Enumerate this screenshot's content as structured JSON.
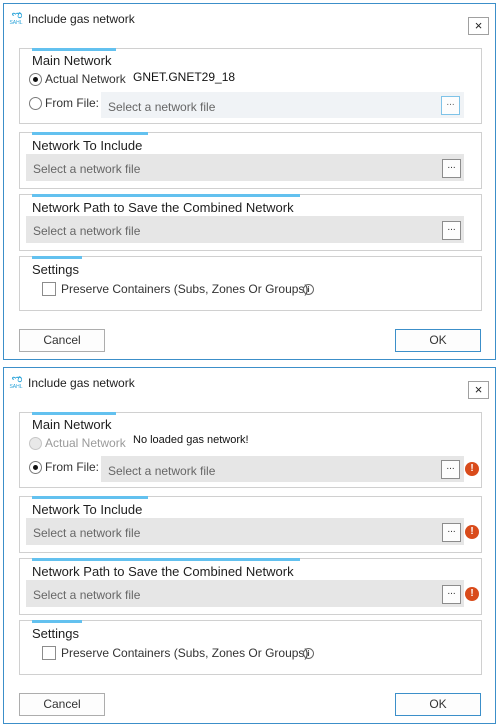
{
  "dialogs": [
    {
      "title": "Include gas network",
      "app_icon_text": "SAHL",
      "close_glyph": "×",
      "main_network": {
        "heading": "Main Network",
        "actual_label": "Actual Network",
        "actual_value": "GNET.GNET29_18",
        "from_file_label": "From File:",
        "file_placeholder": "Select a network file",
        "browse_label": "..."
      },
      "include": {
        "heading": "Network To Include",
        "placeholder": "Select a network file",
        "browse_label": "..."
      },
      "save_path": {
        "heading": "Network Path to Save the Combined Network",
        "placeholder": "Select a network file",
        "browse_label": "..."
      },
      "settings": {
        "heading": "Settings",
        "preserve_label": "Preserve Containers (Subs, Zones Or Groups)",
        "info_glyph": "i"
      },
      "cancel_label": "Cancel",
      "ok_label": "OK"
    },
    {
      "title": "Include gas network",
      "app_icon_text": "SAHL",
      "close_glyph": "×",
      "main_network": {
        "heading": "Main Network",
        "actual_label": "Actual Network",
        "actual_value": "No loaded gas network!",
        "from_file_label": "From File:",
        "file_placeholder": "Select a network file",
        "browse_label": "..."
      },
      "include": {
        "heading": "Network To Include",
        "placeholder": "Select a network file",
        "browse_label": "..."
      },
      "save_path": {
        "heading": "Network Path to Save the Combined Network",
        "placeholder": "Select a network file",
        "browse_label": "..."
      },
      "settings": {
        "heading": "Settings",
        "preserve_label": "Preserve Containers (Subs, Zones Or Groups)",
        "info_glyph": "i"
      },
      "cancel_label": "Cancel",
      "ok_label": "OK"
    }
  ],
  "icons": {
    "error_glyph": "!",
    "error_color": "#d94b1b",
    "accent_color": "#63c1ef",
    "border_color": "#3c8fc9"
  }
}
